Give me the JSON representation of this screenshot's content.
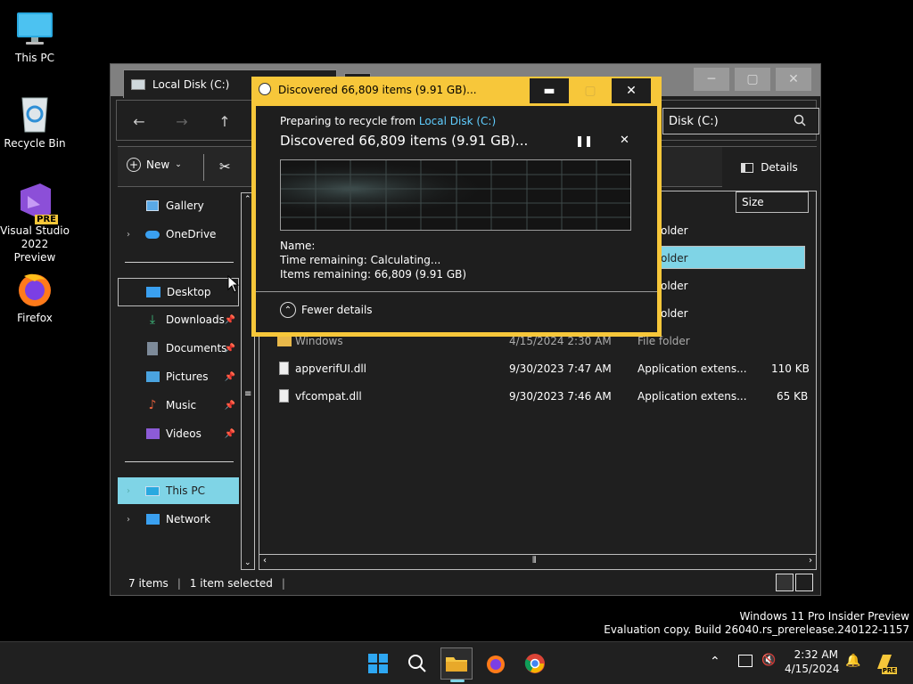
{
  "desktop": {
    "icons": [
      {
        "label": "This PC"
      },
      {
        "label": "Recycle Bin"
      },
      {
        "label": "Visual Studio 2022 Preview",
        "badge": "PRE"
      },
      {
        "label": "Firefox"
      }
    ]
  },
  "explorer": {
    "tab_title": "Local Disk (C:)",
    "address_text": "Disk (C:)",
    "cmd": {
      "new_label": "New",
      "details_label": "Details"
    },
    "nav": {
      "gallery": "Gallery",
      "onedrive": "OneDrive",
      "desktop": "Desktop",
      "downloads": "Downloads",
      "documents": "Documents",
      "pictures": "Pictures",
      "music": "Music",
      "videos": "Videos",
      "thispc": "This PC",
      "network": "Network"
    },
    "columns": {
      "size": "Size"
    },
    "rows": [
      {
        "name": "",
        "date": "",
        "type": "older",
        "size": ""
      },
      {
        "name": "",
        "date": "",
        "type": "older",
        "size": ""
      },
      {
        "name": "",
        "date": "",
        "type": "older",
        "size": ""
      },
      {
        "name": "",
        "date": "",
        "type": "older",
        "size": ""
      },
      {
        "name": "Windows",
        "date": "4/15/2024 2:30 AM",
        "type": "File folder",
        "size": ""
      },
      {
        "name": "appverifUI.dll",
        "date": "9/30/2023 7:47 AM",
        "type": "Application extens...",
        "size": "110 KB"
      },
      {
        "name": "vfcompat.dll",
        "date": "9/30/2023 7:46 AM",
        "type": "Application extens...",
        "size": "65 KB"
      }
    ],
    "status": {
      "items": "7 items",
      "selected": "1 item selected"
    }
  },
  "dialog": {
    "title": "Discovered 66,809 items (9.91 GB)...",
    "preparing_prefix": "Preparing to recycle from ",
    "preparing_link": "Local Disk (C:)",
    "heading": "Discovered 66,809 items (9.91 GB)...",
    "name_label": "Name:",
    "time_label": "Time remaining:",
    "time_value": "Calculating...",
    "items_label": "Items remaining:",
    "items_value": "66,809 (9.91 GB)",
    "fewer_details": "Fewer details"
  },
  "watermark": {
    "line1": "Windows 11 Pro Insider Preview",
    "line2": "Evaluation copy. Build 26040.rs_prerelease.240122-1157"
  },
  "taskbar": {
    "time": "2:32 AM",
    "date": "4/15/2024",
    "badge": "PRE"
  },
  "colors": {
    "accent": "#f7c73a",
    "selection": "#7fd4e6",
    "link": "#60cdff"
  }
}
